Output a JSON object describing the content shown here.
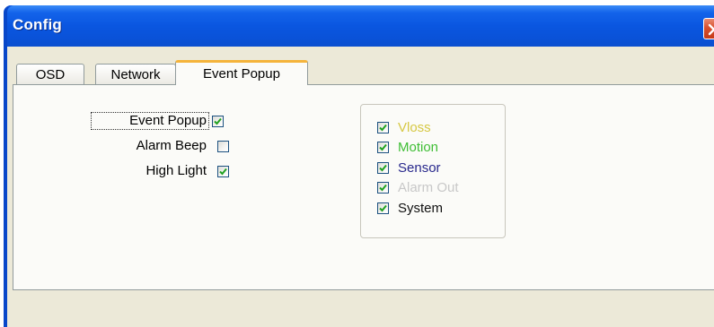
{
  "window": {
    "title": "Config"
  },
  "tabs": [
    {
      "label": "OSD"
    },
    {
      "label": "Network"
    },
    {
      "label": "Event Popup"
    }
  ],
  "options": [
    {
      "label": "Event Popup",
      "checked": true
    },
    {
      "label": "Alarm Beep",
      "checked": false
    },
    {
      "label": "High Light",
      "checked": true
    }
  ],
  "events": [
    {
      "label": "Vloss",
      "checked": true,
      "color": "#d6c844"
    },
    {
      "label": "Motion",
      "checked": true,
      "color": "#3fbe35"
    },
    {
      "label": "Sensor",
      "checked": true,
      "color": "#28288c"
    },
    {
      "label": "Alarm Out",
      "checked": true,
      "color": "#c8c8c8"
    },
    {
      "label": "System",
      "checked": true,
      "color": "#111111"
    }
  ],
  "colors": {
    "titlebar": "#0a56e0",
    "dialog_bg": "#ece9d8",
    "active_tab_accent": "#f5b43b",
    "checkmark": "#21a121"
  },
  "icons": {
    "close": "close-x-icon",
    "check": "checkmark-icon"
  }
}
